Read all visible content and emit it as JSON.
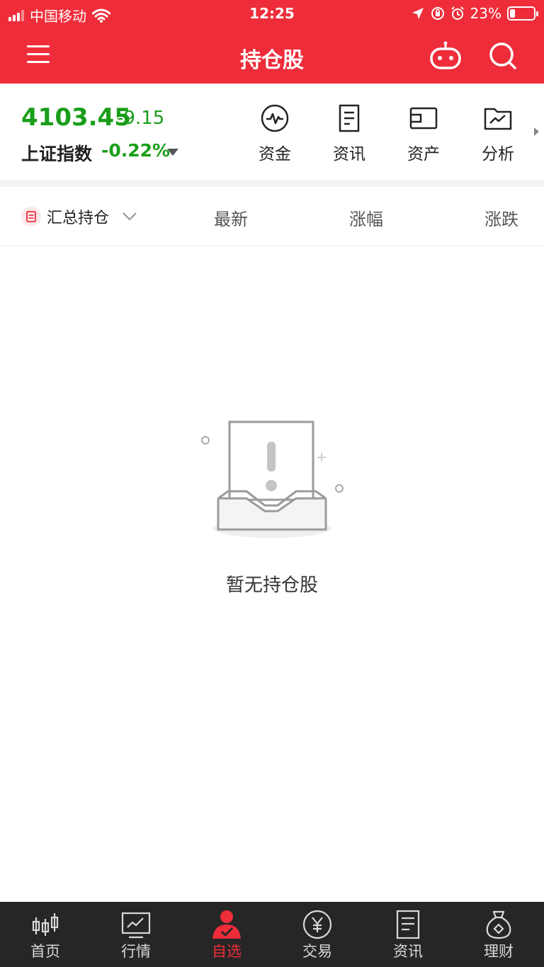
{
  "status_bar": {
    "carrier": "中国移动",
    "time": "12:25",
    "battery": "23%",
    "battery_level": 0.23
  },
  "header": {
    "title": "持仓股",
    "menu_icon": "menu-icon",
    "robot_icon": "robot-icon",
    "search_icon": "search-icon"
  },
  "index": {
    "value": "4103.45",
    "change": "-9.15",
    "name": "上证指数",
    "percent": "-0.22%",
    "color_down": "#1a9e1a"
  },
  "quick_links": [
    {
      "label": "资金",
      "icon": "pulse-icon"
    },
    {
      "label": "资讯",
      "icon": "document-icon"
    },
    {
      "label": "资产",
      "icon": "card-icon"
    },
    {
      "label": "分析",
      "icon": "chart-folder-icon"
    }
  ],
  "columns": {
    "filter_label": "汇总持仓",
    "latest": "最新",
    "change_pct": "涨幅",
    "change_amt": "涨跌"
  },
  "empty": {
    "message": "暂无持仓股"
  },
  "tabs": [
    {
      "label": "首页",
      "icon": "candlestick-icon",
      "active": false
    },
    {
      "label": "行情",
      "icon": "market-chart-icon",
      "active": false
    },
    {
      "label": "自选",
      "icon": "user-check-icon",
      "active": true
    },
    {
      "label": "交易",
      "icon": "yen-icon",
      "active": false
    },
    {
      "label": "资讯",
      "icon": "news-icon",
      "active": false
    },
    {
      "label": "理财",
      "icon": "money-bag-icon",
      "active": false
    }
  ],
  "colors": {
    "brand_red": "#ef2d3a",
    "tabbar_bg": "#262626"
  }
}
